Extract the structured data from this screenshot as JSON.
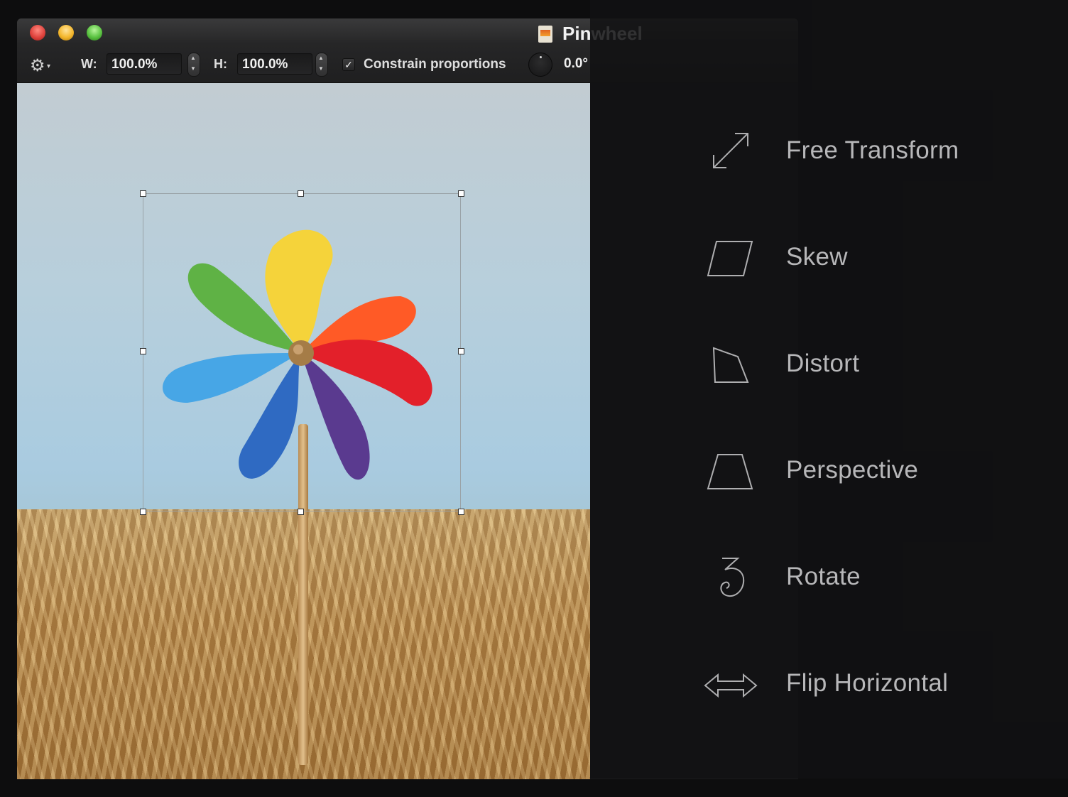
{
  "window": {
    "title": "Pinwheel"
  },
  "toolbar": {
    "width_label": "W:",
    "width_value": "100.0%",
    "height_label": "H:",
    "height_value": "100.0%",
    "constrain_label": "Constrain proportions",
    "constrain_checked": true,
    "checkmark": "✓",
    "angle_value": "0.0°"
  },
  "transform_menu": {
    "items": [
      {
        "label": "Free Transform",
        "icon": "free-transform-icon"
      },
      {
        "label": "Skew",
        "icon": "skew-icon"
      },
      {
        "label": "Distort",
        "icon": "distort-icon"
      },
      {
        "label": "Perspective",
        "icon": "perspective-icon"
      },
      {
        "label": "Rotate",
        "icon": "rotate-icon"
      },
      {
        "label": "Flip Horizontal",
        "icon": "flip-horizontal-icon"
      }
    ]
  },
  "colors": {
    "overlay": "#121213",
    "menu_text": "#b7b7b9"
  }
}
